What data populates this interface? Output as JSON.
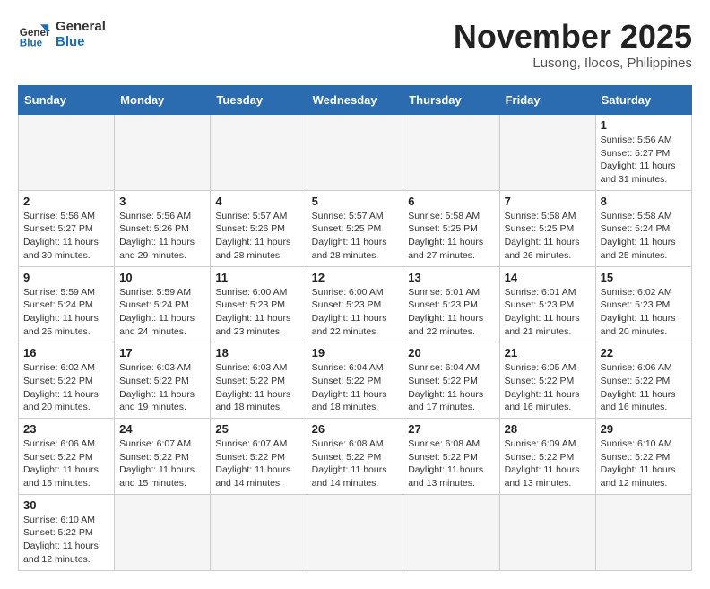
{
  "header": {
    "logo_general": "General",
    "logo_blue": "Blue",
    "month_title": "November 2025",
    "location": "Lusong, Ilocos, Philippines"
  },
  "weekdays": [
    "Sunday",
    "Monday",
    "Tuesday",
    "Wednesday",
    "Thursday",
    "Friday",
    "Saturday"
  ],
  "weeks": [
    [
      {
        "day": "",
        "info": ""
      },
      {
        "day": "",
        "info": ""
      },
      {
        "day": "",
        "info": ""
      },
      {
        "day": "",
        "info": ""
      },
      {
        "day": "",
        "info": ""
      },
      {
        "day": "",
        "info": ""
      },
      {
        "day": "1",
        "info": "Sunrise: 5:56 AM\nSunset: 5:27 PM\nDaylight: 11 hours and 31 minutes."
      }
    ],
    [
      {
        "day": "2",
        "info": "Sunrise: 5:56 AM\nSunset: 5:27 PM\nDaylight: 11 hours and 30 minutes."
      },
      {
        "day": "3",
        "info": "Sunrise: 5:56 AM\nSunset: 5:26 PM\nDaylight: 11 hours and 29 minutes."
      },
      {
        "day": "4",
        "info": "Sunrise: 5:57 AM\nSunset: 5:26 PM\nDaylight: 11 hours and 28 minutes."
      },
      {
        "day": "5",
        "info": "Sunrise: 5:57 AM\nSunset: 5:25 PM\nDaylight: 11 hours and 28 minutes."
      },
      {
        "day": "6",
        "info": "Sunrise: 5:58 AM\nSunset: 5:25 PM\nDaylight: 11 hours and 27 minutes."
      },
      {
        "day": "7",
        "info": "Sunrise: 5:58 AM\nSunset: 5:25 PM\nDaylight: 11 hours and 26 minutes."
      },
      {
        "day": "8",
        "info": "Sunrise: 5:58 AM\nSunset: 5:24 PM\nDaylight: 11 hours and 25 minutes."
      }
    ],
    [
      {
        "day": "9",
        "info": "Sunrise: 5:59 AM\nSunset: 5:24 PM\nDaylight: 11 hours and 25 minutes."
      },
      {
        "day": "10",
        "info": "Sunrise: 5:59 AM\nSunset: 5:24 PM\nDaylight: 11 hours and 24 minutes."
      },
      {
        "day": "11",
        "info": "Sunrise: 6:00 AM\nSunset: 5:23 PM\nDaylight: 11 hours and 23 minutes."
      },
      {
        "day": "12",
        "info": "Sunrise: 6:00 AM\nSunset: 5:23 PM\nDaylight: 11 hours and 22 minutes."
      },
      {
        "day": "13",
        "info": "Sunrise: 6:01 AM\nSunset: 5:23 PM\nDaylight: 11 hours and 22 minutes."
      },
      {
        "day": "14",
        "info": "Sunrise: 6:01 AM\nSunset: 5:23 PM\nDaylight: 11 hours and 21 minutes."
      },
      {
        "day": "15",
        "info": "Sunrise: 6:02 AM\nSunset: 5:23 PM\nDaylight: 11 hours and 20 minutes."
      }
    ],
    [
      {
        "day": "16",
        "info": "Sunrise: 6:02 AM\nSunset: 5:22 PM\nDaylight: 11 hours and 20 minutes."
      },
      {
        "day": "17",
        "info": "Sunrise: 6:03 AM\nSunset: 5:22 PM\nDaylight: 11 hours and 19 minutes."
      },
      {
        "day": "18",
        "info": "Sunrise: 6:03 AM\nSunset: 5:22 PM\nDaylight: 11 hours and 18 minutes."
      },
      {
        "day": "19",
        "info": "Sunrise: 6:04 AM\nSunset: 5:22 PM\nDaylight: 11 hours and 18 minutes."
      },
      {
        "day": "20",
        "info": "Sunrise: 6:04 AM\nSunset: 5:22 PM\nDaylight: 11 hours and 17 minutes."
      },
      {
        "day": "21",
        "info": "Sunrise: 6:05 AM\nSunset: 5:22 PM\nDaylight: 11 hours and 16 minutes."
      },
      {
        "day": "22",
        "info": "Sunrise: 6:06 AM\nSunset: 5:22 PM\nDaylight: 11 hours and 16 minutes."
      }
    ],
    [
      {
        "day": "23",
        "info": "Sunrise: 6:06 AM\nSunset: 5:22 PM\nDaylight: 11 hours and 15 minutes."
      },
      {
        "day": "24",
        "info": "Sunrise: 6:07 AM\nSunset: 5:22 PM\nDaylight: 11 hours and 15 minutes."
      },
      {
        "day": "25",
        "info": "Sunrise: 6:07 AM\nSunset: 5:22 PM\nDaylight: 11 hours and 14 minutes."
      },
      {
        "day": "26",
        "info": "Sunrise: 6:08 AM\nSunset: 5:22 PM\nDaylight: 11 hours and 14 minutes."
      },
      {
        "day": "27",
        "info": "Sunrise: 6:08 AM\nSunset: 5:22 PM\nDaylight: 11 hours and 13 minutes."
      },
      {
        "day": "28",
        "info": "Sunrise: 6:09 AM\nSunset: 5:22 PM\nDaylight: 11 hours and 13 minutes."
      },
      {
        "day": "29",
        "info": "Sunrise: 6:10 AM\nSunset: 5:22 PM\nDaylight: 11 hours and 12 minutes."
      }
    ],
    [
      {
        "day": "30",
        "info": "Sunrise: 6:10 AM\nSunset: 5:22 PM\nDaylight: 11 hours and 12 minutes."
      },
      {
        "day": "",
        "info": ""
      },
      {
        "day": "",
        "info": ""
      },
      {
        "day": "",
        "info": ""
      },
      {
        "day": "",
        "info": ""
      },
      {
        "day": "",
        "info": ""
      },
      {
        "day": "",
        "info": ""
      }
    ]
  ]
}
